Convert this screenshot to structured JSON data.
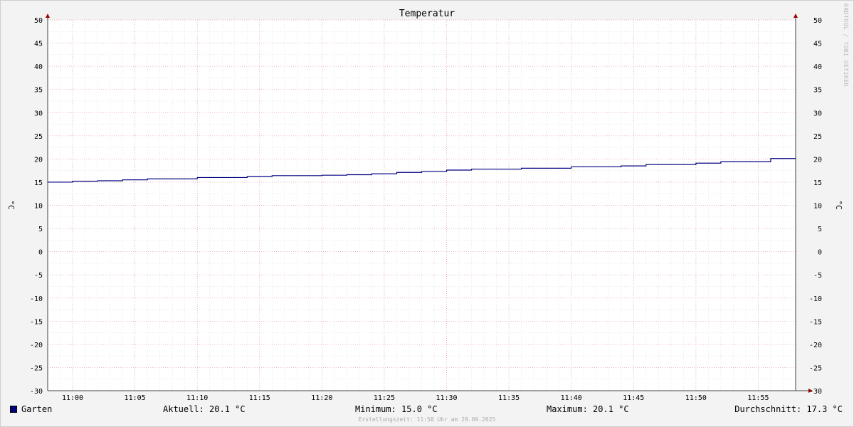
{
  "chart_data": {
    "type": "line",
    "title": "Temperatur",
    "ylabel": "°C",
    "y_right_label": "°C",
    "ylim": [
      -30,
      50
    ],
    "y_ticks": [
      "50",
      "45",
      "40",
      "35",
      "30",
      "25",
      "20",
      "15",
      "10",
      "5",
      "0",
      "-5",
      "-10",
      "-15",
      "-20",
      "-25",
      "-30"
    ],
    "x_tick_labels": [
      "11:00",
      "11:05",
      "11:10",
      "11:15",
      "11:20",
      "11:25",
      "11:30",
      "11:35",
      "11:40",
      "11:45",
      "11:50",
      "11:55"
    ],
    "x_range": [
      "10:58",
      "11:58"
    ],
    "grid": true,
    "step_line": true,
    "series": [
      {
        "name": "Garten",
        "color": "#000080",
        "x": [
          "10:58",
          "11:00",
          "11:02",
          "11:04",
          "11:06",
          "11:10",
          "11:14",
          "11:16",
          "11:20",
          "11:22",
          "11:24",
          "11:26",
          "11:28",
          "11:30",
          "11:32",
          "11:36",
          "11:40",
          "11:44",
          "11:46",
          "11:50",
          "11:52",
          "11:56"
        ],
        "values": [
          15.0,
          15.2,
          15.3,
          15.5,
          15.7,
          16.0,
          16.2,
          16.4,
          16.5,
          16.6,
          16.8,
          17.1,
          17.3,
          17.6,
          17.8,
          18.0,
          18.3,
          18.5,
          18.8,
          19.1,
          19.4,
          20.1
        ]
      }
    ]
  },
  "legend": {
    "series_label": "Garten",
    "swatch_color": "#000080",
    "current": "Aktuell: 20.1 °C",
    "minimum": "Minimum: 15.0 °C",
    "maximum": "Maximum: 20.1 °C",
    "average": "Durchschnitt: 17.3 °C"
  },
  "watermark": "RRDTOOL / TOBI OETIKER",
  "footer": "Erstellungszeit: 11:58 Uhr am 29.09.2025"
}
